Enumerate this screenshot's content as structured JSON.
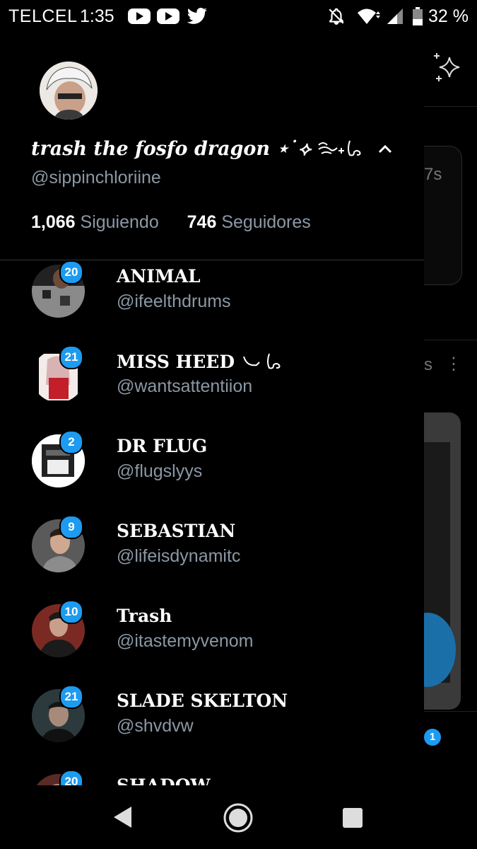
{
  "status_bar": {
    "carrier": "TELCEL",
    "time": "1:35",
    "battery": "32 %"
  },
  "profile": {
    "display_name": "trash the fosfo dragon ⋆˙⟡ ",
    "handle": "@sippinchloriine",
    "following_count": "1,066",
    "following_label": "Siguiendo",
    "followers_count": "746",
    "followers_label": "Seguidores"
  },
  "accounts": [
    {
      "name": "ANIMAL",
      "handle": "@ifeelthdrums",
      "badge": "20"
    },
    {
      "name": "MISS HEED ",
      "handle": "@wantsattentiion",
      "badge": "21"
    },
    {
      "name": "DR FLUG",
      "handle": "@flugslyys",
      "badge": "2"
    },
    {
      "name": "SEBASTIAN",
      "handle": "@lifeisdynamitc",
      "badge": "9"
    },
    {
      "name": "Trash",
      "handle": "@itastemyvenom",
      "badge": "10"
    },
    {
      "name": "SLADE SKELTON",
      "handle": "@shvdvw",
      "badge": "21"
    },
    {
      "name": "SHADOW",
      "handle": "",
      "badge": "20"
    }
  ],
  "background": {
    "time_ago": "7s",
    "menu_text": "s",
    "notification_badge": "1"
  },
  "colors": {
    "accent": "#1d9bf0",
    "secondary_text": "#8b98a5",
    "background": "#000000"
  }
}
